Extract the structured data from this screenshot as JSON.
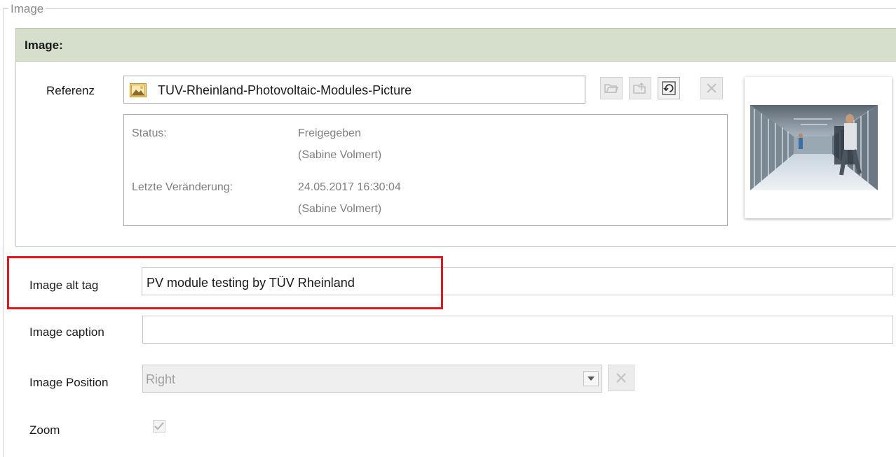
{
  "fieldset": {
    "legend": "Image"
  },
  "group": {
    "title": "Image:"
  },
  "reference": {
    "label": "Referenz",
    "value": "TUV-Rheinland-Photovoltaic-Modules-Picture",
    "icon": "image-file-icon",
    "toolbar": [
      "open-folder-icon",
      "upload-folder-icon",
      "refresh-icon",
      "remove-icon"
    ]
  },
  "info": {
    "status_label": "Status:",
    "status_value": "Freigegeben",
    "status_user": "(Sabine Volmert)",
    "changed_label": "Letzte Veränderung:",
    "changed_value": "24.05.2017 16:30:04",
    "changed_user": "(Sabine Volmert)"
  },
  "fields": {
    "alt_label": "Image alt tag",
    "alt_value": "PV module testing by TÜV Rheinland",
    "caption_label": "Image caption",
    "caption_value": "",
    "position_label": "Image Position",
    "position_value": "Right",
    "zoom_label": "Zoom",
    "zoom_checked": true
  },
  "colors": {
    "header_bg": "#d6dfcc",
    "highlight": "#e2161c"
  }
}
